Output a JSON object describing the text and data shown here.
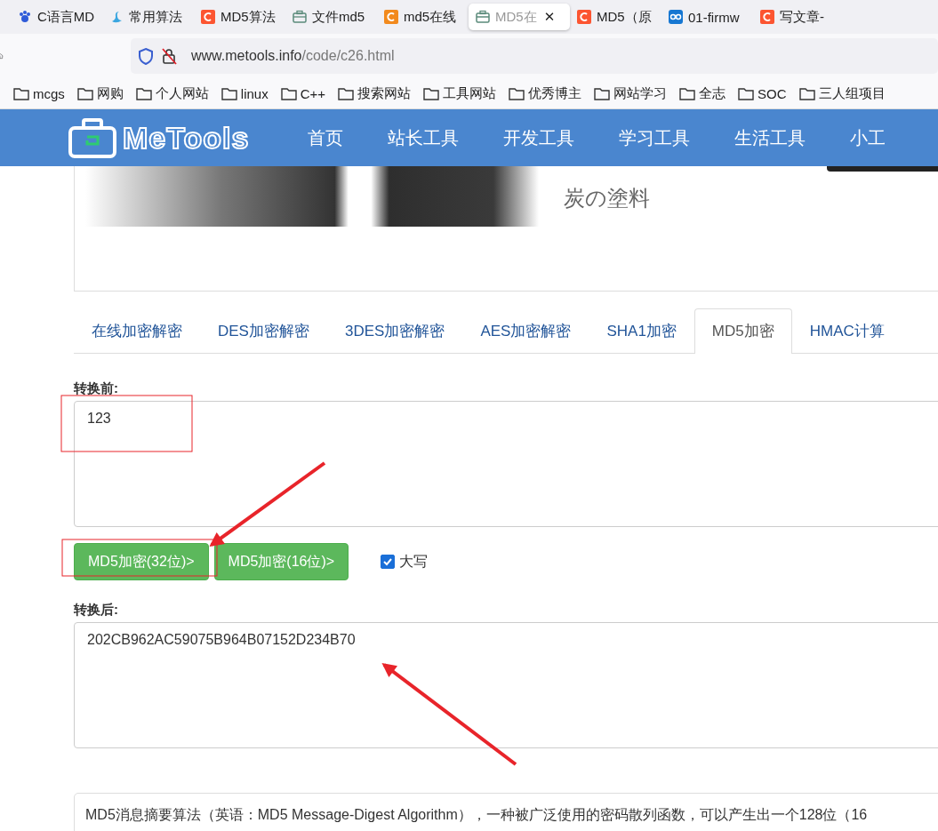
{
  "browser_tabs": [
    {
      "title": "C语言MD",
      "selected": false
    },
    {
      "title": "常用算法",
      "selected": false
    },
    {
      "title": "MD5算法",
      "selected": false
    },
    {
      "title": "文件md5",
      "selected": false
    },
    {
      "title": "md5在线",
      "selected": false
    },
    {
      "title": "MD5在",
      "selected": true,
      "close": "✕"
    },
    {
      "title": "MD5（原",
      "selected": false
    },
    {
      "title": "01-firmw",
      "selected": false
    },
    {
      "title": "写文章-",
      "selected": false
    }
  ],
  "address_bar": {
    "host": "www.metools.info",
    "path": "/code/c26.html"
  },
  "bookmarks": [
    "mcgs",
    "网购",
    "个人网站",
    "linux",
    "C++",
    "搜索网站",
    "工具网站",
    "优秀博主",
    "网站学习",
    "全志",
    "SOC",
    "三人组项目"
  ],
  "site_nav": {
    "logo": "MeTools",
    "items": [
      "首页",
      "站长工具",
      "开发工具",
      "学习工具",
      "生活工具",
      "小工"
    ]
  },
  "banner": {
    "caption": "炭の塗料"
  },
  "tabs": [
    {
      "label": "在线加密解密",
      "selected": false
    },
    {
      "label": "DES加密解密",
      "selected": false
    },
    {
      "label": "3DES加密解密",
      "selected": false
    },
    {
      "label": "AES加密解密",
      "selected": false
    },
    {
      "label": "SHA1加密",
      "selected": false
    },
    {
      "label": "MD5加密",
      "selected": true
    },
    {
      "label": "HMAC计算",
      "selected": false
    }
  ],
  "input": {
    "label": "转换前:",
    "value": "123"
  },
  "buttons": [
    "MD5加密(32位)>",
    "MD5加密(16位)>"
  ],
  "uppercase": {
    "label": "大写",
    "checked": true
  },
  "output": {
    "label": "转换后:",
    "value": "202CB962AC59075B964B07152D234B70"
  },
  "description": "MD5消息摘要算法（英语：MD5 Message-Digest Algorithm），一种被广泛使用的密码散列函数，可以产生出一个128位（16",
  "annotations": [
    {
      "kind": "box"
    },
    {
      "kind": "box"
    },
    {
      "kind": "arrow"
    },
    {
      "kind": "arrow"
    }
  ]
}
